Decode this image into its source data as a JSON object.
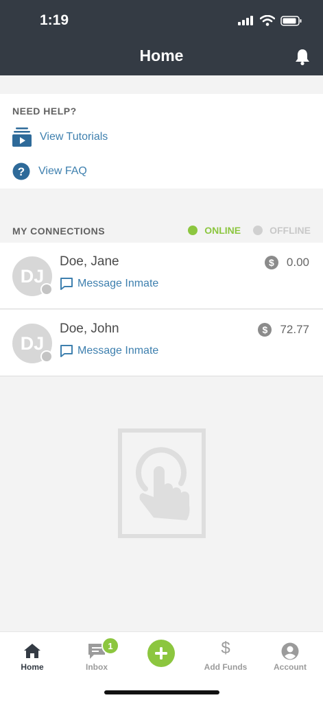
{
  "status_bar": {
    "time": "1:19"
  },
  "header": {
    "title": "Home"
  },
  "help": {
    "label": "NEED HELP?",
    "items": [
      {
        "label": "View Tutorials",
        "icon": "tutorials-icon"
      },
      {
        "label": "View FAQ",
        "icon": "faq-icon"
      }
    ]
  },
  "connections": {
    "label": "MY CONNECTIONS",
    "online_label": "ONLINE",
    "offline_label": "OFFLINE",
    "items": [
      {
        "initials": "DJ",
        "name": "Doe, Jane",
        "message_label": "Message Inmate",
        "balance": "0.00"
      },
      {
        "initials": "DJ",
        "name": "Doe, John",
        "message_label": "Message Inmate",
        "balance": "72.77"
      }
    ]
  },
  "tabbar": {
    "items": [
      {
        "label": "Home",
        "icon": "home-icon"
      },
      {
        "label": "Inbox",
        "icon": "inbox-icon",
        "badge": "1"
      },
      {
        "label": "",
        "icon": "plus-icon"
      },
      {
        "label": "Add Funds",
        "icon": "dollar-icon"
      },
      {
        "label": "Account",
        "icon": "account-icon"
      }
    ]
  },
  "colors": {
    "header": "#343b44",
    "accent_green": "#8cc63f",
    "link_blue": "#3d7fae",
    "offline_gray": "#d0d0d0"
  }
}
